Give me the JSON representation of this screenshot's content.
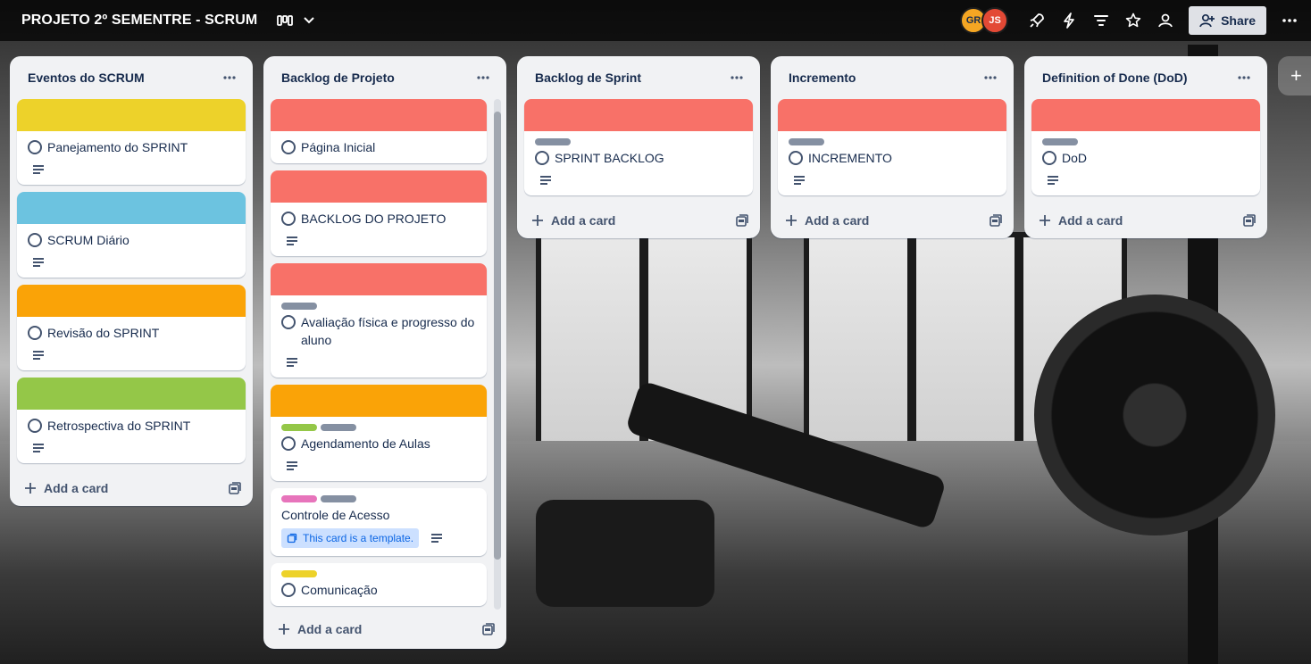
{
  "header": {
    "board_title": "PROJETO 2º SEMENTRE - SCRUM",
    "view_icon": "board-view-icon",
    "members": [
      {
        "initials": "GR",
        "color": "#f5a623"
      },
      {
        "initials": "JS",
        "color": "#e34935"
      }
    ],
    "share_label": "Share"
  },
  "colors": {
    "yellow": "#edd22a",
    "blue": "#6cc3e0",
    "orange": "#faa307",
    "green": "#94c748",
    "red": "#f87168",
    "gray": "#8590a2",
    "pink": "#e774bb"
  },
  "lists": [
    {
      "title": "Eventos do SCRUM",
      "add_card_label": "Add a card",
      "cards": [
        {
          "cover": "#edd22a",
          "title": "Panejamento do SPRINT"
        },
        {
          "cover": "#6cc3e0",
          "title": "SCRUM Diário"
        },
        {
          "cover": "#faa307",
          "title": "Revisão do SPRINT"
        },
        {
          "cover": "#94c748",
          "title": "Retrospectiva do SPRINT"
        }
      ]
    },
    {
      "title": "Backlog de Projeto",
      "add_card_label": "Add a card",
      "cards": [
        {
          "cover": "#f87168",
          "title": "Página Inicial"
        },
        {
          "cover": "#f87168",
          "title": "BACKLOG DO PROJETO"
        },
        {
          "cover": "#f87168",
          "labels": [
            "#8590a2"
          ],
          "title": "Avaliação física e progresso do aluno"
        },
        {
          "cover": "#faa307",
          "labels": [
            "#94c748",
            "#8590a2"
          ],
          "title": "Agendamento de Aulas"
        },
        {
          "labels": [
            "#e774bb",
            "#8590a2"
          ],
          "title": "Controle de Acesso",
          "template_badge": "This card is a template."
        },
        {
          "labels": [
            "#edd22a"
          ],
          "title": "Comunicação"
        }
      ]
    },
    {
      "title": "Backlog de Sprint",
      "add_card_label": "Add a card",
      "cards": [
        {
          "cover": "#f87168",
          "labels": [
            "#8590a2"
          ],
          "title": "SPRINT BACKLOG"
        }
      ]
    },
    {
      "title": "Incremento",
      "add_card_label": "Add a card",
      "cards": [
        {
          "cover": "#f87168",
          "labels": [
            "#8590a2"
          ],
          "title": "INCREMENTO"
        }
      ]
    },
    {
      "title": "Definition of Done (DoD)",
      "add_card_label": "Add a card",
      "cards": [
        {
          "cover": "#f87168",
          "labels": [
            "#8590a2"
          ],
          "title": "DoD"
        }
      ]
    }
  ]
}
